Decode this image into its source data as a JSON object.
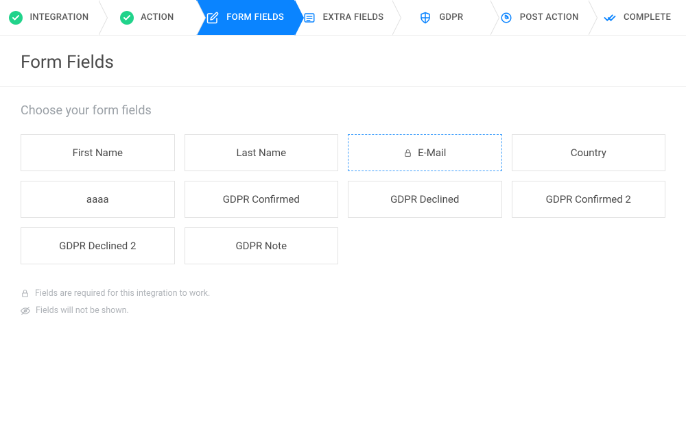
{
  "stepper": {
    "steps": [
      {
        "label": "INTEGRATION",
        "state": "done"
      },
      {
        "label": "ACTION",
        "state": "done"
      },
      {
        "label": "FORM FIELDS",
        "state": "active",
        "icon": "edit"
      },
      {
        "label": "EXTRA FIELDS",
        "state": "upcoming",
        "icon": "form"
      },
      {
        "label": "GDPR",
        "state": "upcoming",
        "icon": "shield"
      },
      {
        "label": "POST ACTION",
        "state": "upcoming",
        "icon": "rocket"
      },
      {
        "label": "COMPLETE",
        "state": "upcoming",
        "icon": "check"
      }
    ]
  },
  "page": {
    "title": "Form Fields",
    "instruction": "Choose your form fields"
  },
  "fields": [
    {
      "label": "First Name",
      "required": false,
      "selected": false
    },
    {
      "label": "Last Name",
      "required": false,
      "selected": false
    },
    {
      "label": "E-Mail",
      "required": true,
      "selected": true
    },
    {
      "label": "Country",
      "required": false,
      "selected": false
    },
    {
      "label": "aaaa",
      "required": false,
      "selected": false
    },
    {
      "label": "GDPR Confirmed",
      "required": false,
      "selected": false
    },
    {
      "label": "GDPR Declined",
      "required": false,
      "selected": false
    },
    {
      "label": "GDPR Confirmed 2",
      "required": false,
      "selected": false
    },
    {
      "label": "GDPR Declined 2",
      "required": false,
      "selected": false
    },
    {
      "label": "GDPR Note",
      "required": false,
      "selected": false
    }
  ],
  "notes": {
    "required": "Fields are required for this integration to work.",
    "hidden": "Fields will not be shown."
  }
}
